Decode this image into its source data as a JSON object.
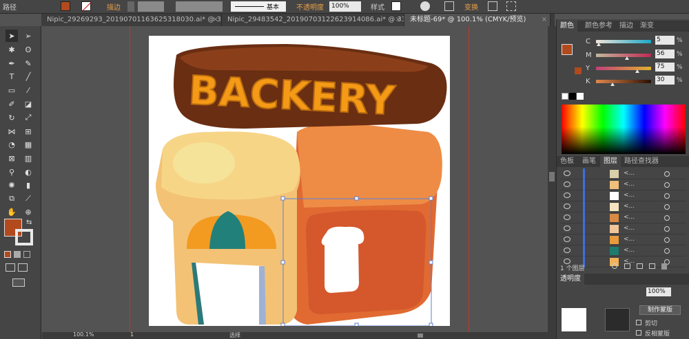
{
  "control_bar": {
    "object_type": "路径",
    "stroke_label": "描边",
    "stroke_profile": "基本",
    "opacity_label": "不透明度",
    "opacity_value": "100%",
    "style_label": "样式",
    "transform_label": "变换",
    "fill_color": "#b24a1d"
  },
  "tabs": [
    {
      "label": "Nipic_29269293_20190701163625318030.ai* @ 33...",
      "close": "×"
    },
    {
      "label": "Nipic_29483542_20190703122623914086.ai* @ 33...",
      "close": "×"
    },
    {
      "label": "未标题-69* @ 100.1% (CMYK/预览)",
      "close": "×"
    }
  ],
  "toolbar": {
    "fill_color": "#b24a1d",
    "stroke_color": "#e8e8e8"
  },
  "artwork": {
    "sign_text": "BACKERY"
  },
  "color_panel": {
    "tabs": [
      "颜色",
      "颜色参考",
      "描边",
      "渐变"
    ],
    "channels": [
      {
        "label": "C",
        "value": "5",
        "pct": "%",
        "level": 0.05
      },
      {
        "label": "M",
        "value": "56",
        "pct": "%",
        "level": 0.56
      },
      {
        "label": "Y",
        "value": "75",
        "pct": "%",
        "level": 0.75
      },
      {
        "label": "K",
        "value": "30",
        "pct": "%",
        "level": 0.3
      }
    ],
    "swatch": "#b24a1d"
  },
  "layers_panel": {
    "tabs": [
      "色板",
      "画笔",
      "图层",
      "路径查找器"
    ],
    "rows": [
      {
        "name": "<...",
        "thumb_color": "#d9cfa8"
      },
      {
        "name": "<...",
        "thumb_color": "#f0c07a"
      },
      {
        "name": "<...",
        "thumb_color": "#ffffff"
      },
      {
        "name": "<...",
        "thumb_color": "#f4e4c0"
      },
      {
        "name": "<...",
        "thumb_color": "#d98a45"
      },
      {
        "name": "<...",
        "thumb_color": "#efc59a"
      },
      {
        "name": "<...",
        "thumb_color": "#e89a3c"
      },
      {
        "name": "<...",
        "thumb_color": "#1e7c6e"
      },
      {
        "name": "<...",
        "thumb_color": "#f1b35a"
      }
    ],
    "footer": "1 个图层"
  },
  "transparency_panel": {
    "label": "透明度",
    "opacity": "100%",
    "make_mask": "制作蒙版",
    "clip": "剪切",
    "invert_mask": "反相蒙版"
  },
  "status_bar": {
    "zoom": "100.1%",
    "page": "1",
    "tool_name": "选择"
  }
}
